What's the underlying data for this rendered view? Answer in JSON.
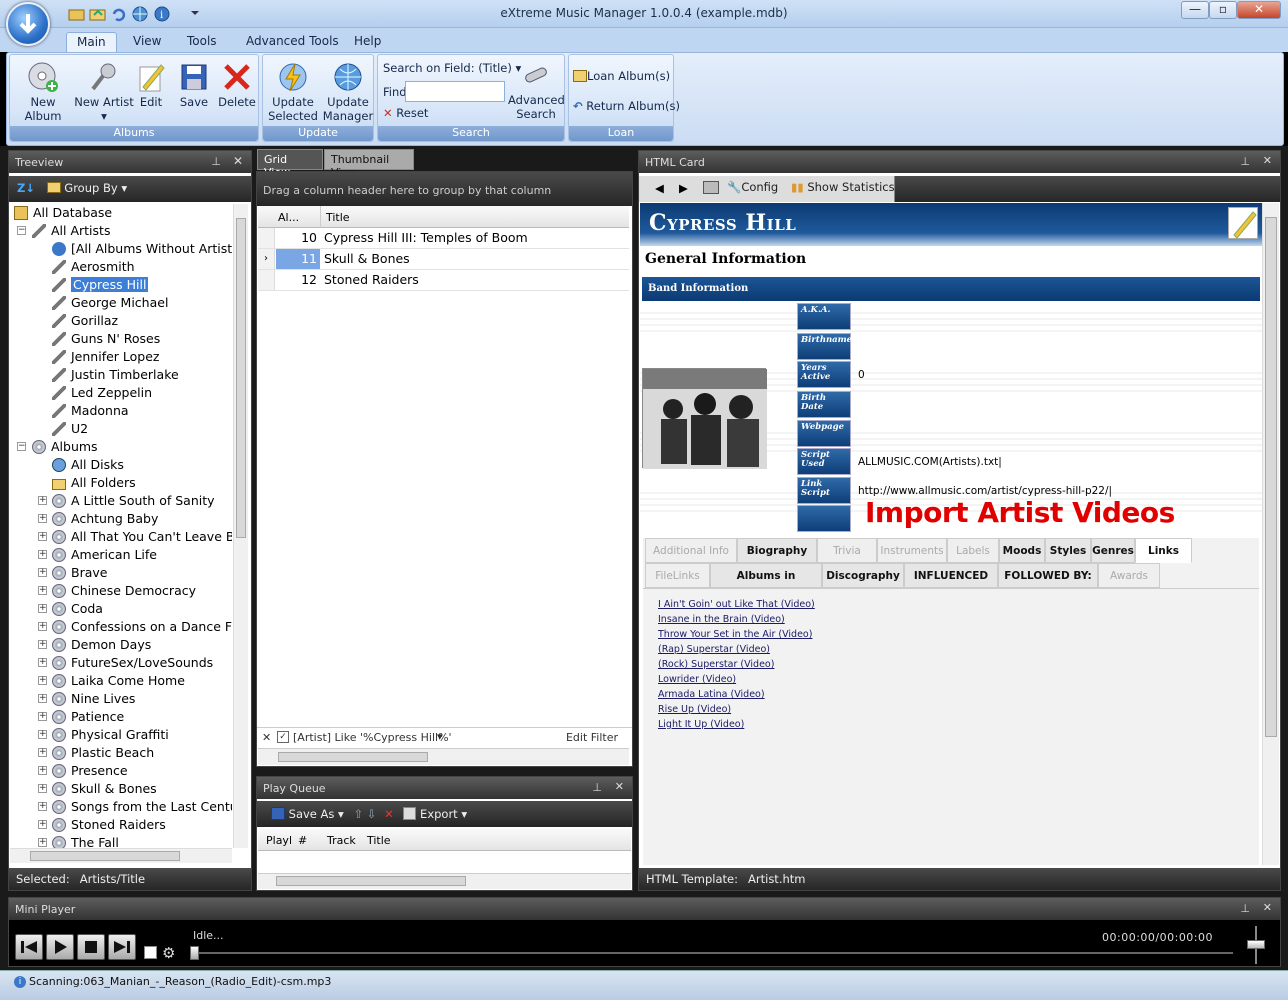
{
  "window": {
    "title": "eXtreme Music Manager 1.0.0.4 (example.mdb)",
    "controls": [
      "minimize-button",
      "maximize-button",
      "close-button"
    ]
  },
  "ribbon": {
    "tabs": [
      "Main",
      "View",
      "Tools",
      "Advanced Tools",
      "Help"
    ],
    "active_tab": "Main",
    "albums_group": {
      "label": "Albums",
      "buttons": [
        "New Album",
        "New Artist",
        "Edit",
        "Save",
        "Delete"
      ]
    },
    "update_group": {
      "label": "Update",
      "buttons": [
        "Update Selected",
        "Update Manager"
      ],
      "update_selected_line1": "Update",
      "update_selected_line2": "Selected",
      "update_manager_line1": "Update",
      "update_manager_line2": "Manager"
    },
    "search_group": {
      "label": "Search",
      "field_label": "Search on Field: (Title)",
      "find_label": "Find",
      "find_value": "",
      "reset_label": "Reset",
      "advanced_line1": "Advanced",
      "advanced_line2": "Search"
    },
    "loan_group": {
      "label": "Loan",
      "loan_albums": "Loan Album(s)",
      "return_albums": "Return Album(s)"
    }
  },
  "treeview": {
    "title": "Treeview",
    "group_by": "Group By",
    "root": "All Database",
    "artists_node": "All Artists",
    "artists": [
      "[All Albums Without Artist]",
      "Aerosmith",
      "Cypress Hill",
      "George Michael",
      "Gorillaz",
      "Guns N' Roses",
      "Jennifer Lopez",
      "Justin Timberlake",
      "Led Zeppelin",
      "Madonna",
      "U2"
    ],
    "selected_artist": "Cypress Hill",
    "albums_node": "Albums",
    "album_special": [
      "All Disks",
      "All Folders"
    ],
    "albums": [
      "A Little South of Sanity",
      "Achtung Baby",
      "All That You Can't Leave Be",
      "American Life",
      "Brave",
      "Chinese Democracy",
      "Coda",
      "Confessions on a Dance Flo",
      "Demon Days",
      "FutureSex/LoveSounds",
      "Laika Come Home",
      "Nine Lives",
      "Patience",
      "Physical Graffiti",
      "Plastic Beach",
      "Presence",
      "Skull & Bones",
      "Songs from the Last Centur",
      "Stoned Raiders",
      "The Fall"
    ],
    "status_label": "Selected:",
    "status_value": "Artists/Title"
  },
  "grid": {
    "tabs": [
      "Grid View",
      "Thumbnail View"
    ],
    "active_tab": "Grid View",
    "group_hint": "Drag a column header here to group by that column",
    "columns": [
      "Al...",
      "Title"
    ],
    "rows": [
      {
        "num": "10",
        "title": "Cypress Hill III: Temples of Boom"
      },
      {
        "num": "11",
        "title": "Skull & Bones"
      },
      {
        "num": "12",
        "title": "Stoned Raiders"
      }
    ],
    "filter": "[Artist] Like '%Cypress Hill%'",
    "edit_filter": "Edit Filter"
  },
  "play_queue": {
    "title": "Play Queue",
    "save_as": "Save As",
    "export": "Export",
    "columns": [
      "Playl",
      "#",
      "Track",
      "Title"
    ]
  },
  "html_card": {
    "title": "HTML Card",
    "config": "Config",
    "show_statistics": "Show Statistics",
    "artist_name": "Cypress Hill",
    "general_info": "General Information",
    "band_info": "Band Information",
    "fields": [
      {
        "label": "A.K.A.",
        "value": ""
      },
      {
        "label": "Birthname",
        "value": ""
      },
      {
        "label": "Years Active",
        "value": "0"
      },
      {
        "label": "Birth Date",
        "value": ""
      },
      {
        "label": "Webpage",
        "value": ""
      },
      {
        "label": "Script Used",
        "value": "ALLMUSIC.COM(Artists).txt|"
      },
      {
        "label": "Link Script",
        "value": "http://www.allmusic.com/artist/cypress-hill-p22/|"
      },
      {
        "label": "",
        "value": ""
      }
    ],
    "annotation": "Import Artist Videos",
    "tabs_row1": [
      "Additional Info",
      "Biography",
      "Trivia",
      "Instruments",
      "Labels",
      "Moods",
      "Styles",
      "Genres",
      "Links"
    ],
    "tabs_row2": [
      "FileLinks",
      "Albums in Database",
      "Discography",
      "INFLUENCED BY:",
      "FOLLOWED BY:",
      "Awards"
    ],
    "active_tab": "Links",
    "video_links": [
      "I Ain't Goin' out Like That (Video)",
      "Insane in the Brain (Video)",
      "Throw Your Set in the Air (Video)",
      "(Rap) Superstar (Video)",
      "(Rock) Superstar (Video)",
      "Lowrider (Video)",
      "Armada Latina (Video)",
      "Rise Up (Video)",
      "Light It Up (Video)"
    ],
    "template_label": "HTML Template:",
    "template_value": "Artist.htm"
  },
  "mini_player": {
    "title": "Mini Player",
    "status": "Idle...",
    "time": "00:00:00/00:00:00"
  },
  "statusbar": {
    "text": "Scanning:063_Manian_-_Reason_(Radio_Edit)-csm.mp3"
  },
  "colors": {
    "ribbon_bg": "#cbdcf3",
    "panel_dark": "#333333",
    "card_header": "#0e3e78",
    "annotation_red": "#e00000",
    "selection": "#3c7fd8"
  }
}
